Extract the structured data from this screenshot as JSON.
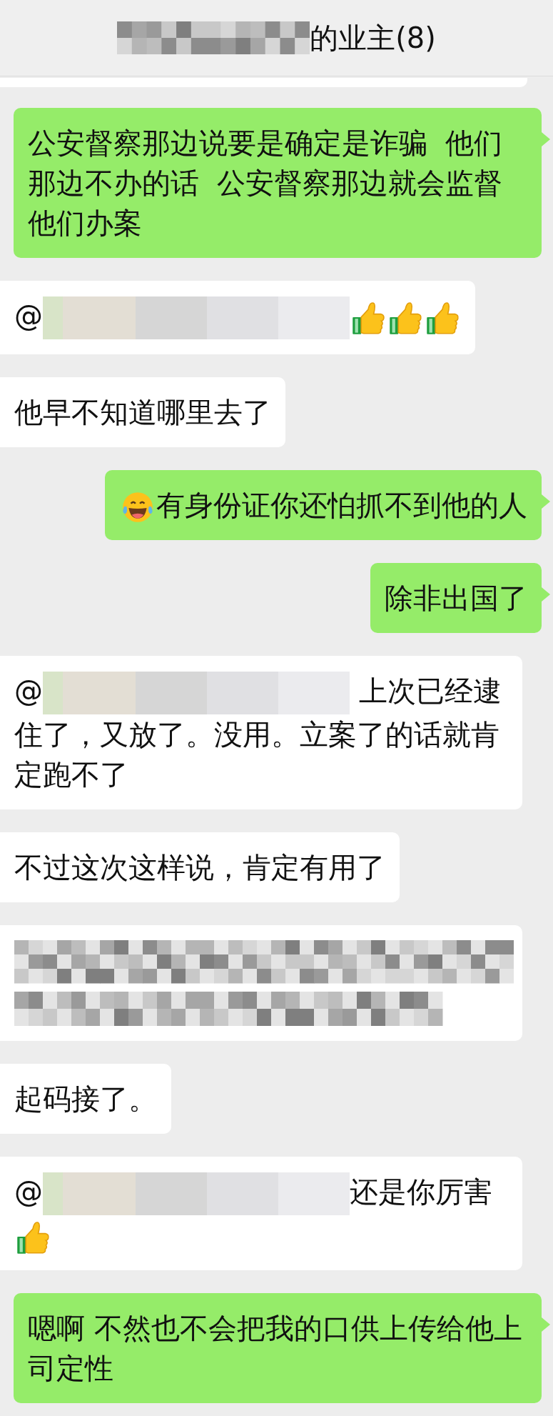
{
  "header": {
    "title": "的业主(8)"
  },
  "messages": [
    {
      "outgoing": false,
      "kind": "cut"
    },
    {
      "outgoing": true,
      "kind": "normal",
      "parts": [
        {
          "kind": "text",
          "text": "公安督察那边说要是确定是诈骗  他们那边不办的话  公安督察那边就会监督他们办案"
        }
      ]
    },
    {
      "outgoing": false,
      "kind": "normal",
      "parts": [
        {
          "kind": "text",
          "text": "@"
        },
        {
          "kind": "mention_mosaic"
        },
        {
          "kind": "thumbs_up"
        },
        {
          "kind": "thumbs_up"
        },
        {
          "kind": "thumbs_up"
        }
      ]
    },
    {
      "outgoing": false,
      "kind": "normal",
      "parts": [
        {
          "kind": "text",
          "text": "他早不知道哪里去了"
        }
      ]
    },
    {
      "outgoing": true,
      "kind": "normal",
      "parts": [
        {
          "kind": "laugh"
        },
        {
          "kind": "text",
          "text": "有身份证你还怕抓不到他的人"
        }
      ]
    },
    {
      "outgoing": true,
      "kind": "normal",
      "parts": [
        {
          "kind": "text",
          "text": "除非出国了"
        }
      ]
    },
    {
      "outgoing": false,
      "kind": "normal",
      "parts": [
        {
          "kind": "text",
          "text": "@"
        },
        {
          "kind": "mention_mosaic"
        },
        {
          "kind": "text",
          "text": " 上次已经逮"
        },
        {
          "kind": "text_block",
          "text": "住了，又放了。没用。立案了的话就肯定跑不了"
        }
      ]
    },
    {
      "outgoing": false,
      "kind": "normal",
      "parts": [
        {
          "kind": "text",
          "text": "不过这次这样说，肯定有用了"
        }
      ]
    },
    {
      "outgoing": false,
      "kind": "normal",
      "parts": [
        {
          "kind": "text_mosaic"
        }
      ]
    },
    {
      "outgoing": false,
      "kind": "normal",
      "parts": [
        {
          "kind": "text",
          "text": "起码接了。"
        }
      ]
    },
    {
      "outgoing": false,
      "kind": "normal",
      "parts": [
        {
          "kind": "text",
          "text": "@"
        },
        {
          "kind": "mention_mosaic"
        },
        {
          "kind": "text",
          "text": "还是你厉害"
        },
        {
          "kind": "thumbs_up"
        }
      ]
    },
    {
      "outgoing": true,
      "kind": "normal",
      "parts": [
        {
          "kind": "text",
          "text": "嗯啊 不然也不会把我的口供上传给他上司定性"
        }
      ]
    }
  ]
}
